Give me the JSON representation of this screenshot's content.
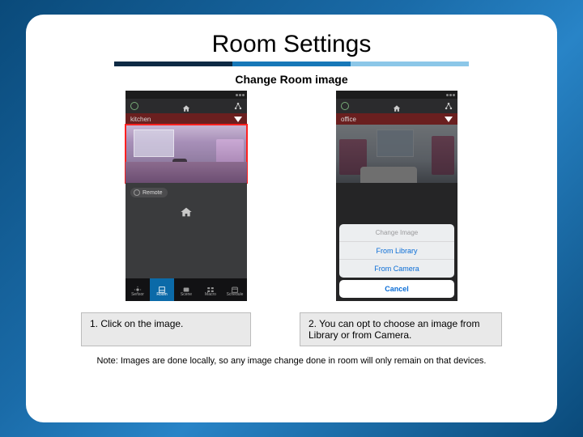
{
  "title": "Room Settings",
  "subtitle": "Change Room image",
  "phone1": {
    "room_name": "kitchen",
    "remote_label": "Remote",
    "tabs": [
      {
        "label": "Sensor"
      },
      {
        "label": "Room"
      },
      {
        "label": "Scene"
      },
      {
        "label": "Macro"
      },
      {
        "label": "Schedule"
      }
    ]
  },
  "phone2": {
    "room_name": "office",
    "action_sheet": {
      "header": "Change Image",
      "option1": "From Library",
      "option2": "From Camera",
      "cancel": "Cancel"
    }
  },
  "caption1": "1. Click on the image.",
  "caption2": "2. You can opt to choose an image from Library or from Camera.",
  "note": "Note: Images are done locally, so any image change done in room will only remain on that devices."
}
